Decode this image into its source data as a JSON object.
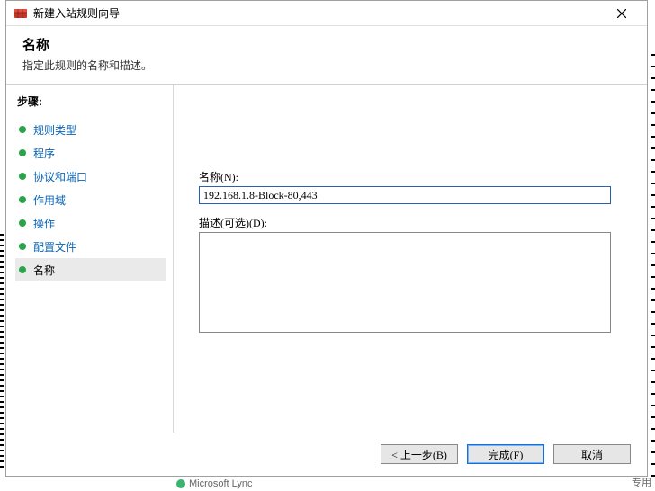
{
  "window": {
    "title": "新建入站规则向导"
  },
  "header": {
    "title": "名称",
    "subtitle": "指定此规则的名称和描述。"
  },
  "sidebar": {
    "title": "步骤:",
    "items": [
      {
        "label": "规则类型"
      },
      {
        "label": "程序"
      },
      {
        "label": "协议和端口"
      },
      {
        "label": "作用域"
      },
      {
        "label": "操作"
      },
      {
        "label": "配置文件"
      },
      {
        "label": "名称"
      }
    ],
    "current_index": 6
  },
  "form": {
    "name_label": "名称(N):",
    "name_value": "192.168.1.8-Block-80,443",
    "desc_label": "描述(可选)(D):",
    "desc_value": ""
  },
  "buttons": {
    "back": "< 上一步(B)",
    "finish": "完成(F)",
    "cancel": "取消"
  },
  "background": {
    "left_item": "Microsoft Lync",
    "right_item": "专用"
  }
}
